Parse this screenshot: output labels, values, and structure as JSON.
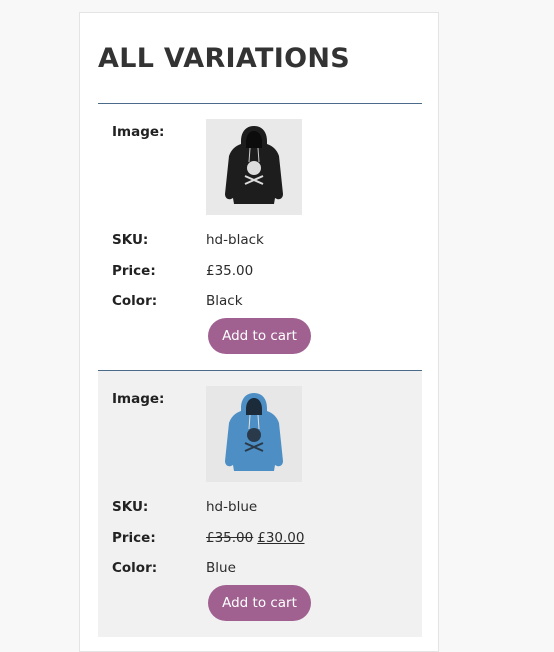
{
  "page": {
    "title": "ALL VARIATIONS"
  },
  "labels": {
    "image": "Image:",
    "sku": "SKU:",
    "price": "Price:",
    "color": "Color:"
  },
  "colors": {
    "button": "#a06191",
    "divider": "#4b6b8a"
  },
  "variations": [
    {
      "image_icon": "hoodie-black-icon",
      "sku": "hd-black",
      "price": "£35.00",
      "color": "Black",
      "button_label": "Add to cart"
    },
    {
      "image_icon": "hoodie-blue-icon",
      "sku": "hd-blue",
      "regular_price": "£35.00",
      "sale_price": "£30.00",
      "color": "Blue",
      "button_label": "Add to cart"
    }
  ]
}
